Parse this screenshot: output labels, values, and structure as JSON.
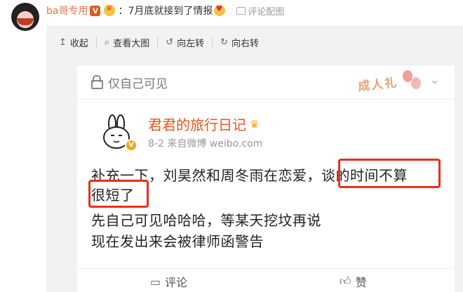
{
  "comment": {
    "username": "ba哥专用",
    "text": "7月底就接到了情报",
    "image_link": "评论配图"
  },
  "toolbar": {
    "items": [
      {
        "icon": "↥",
        "label": "收起"
      },
      {
        "icon": "⌕",
        "label": "查看大图"
      },
      {
        "icon": "↺",
        "label": "向左转"
      },
      {
        "icon": "↻",
        "label": "向右转"
      }
    ]
  },
  "screenshot": {
    "visibility": "仅自己可见",
    "badge": "成人礼",
    "post": {
      "author": "君君的旅行日记",
      "meta": "8-2  来自微博 weibo.com",
      "lines": [
        "补充一下，刘昊然和周冬雨在恋爱，谈的时间不算",
        "很短了",
        "先自己可见哈哈哈，等某天挖坟再说",
        "现在发出来会被律师函警告"
      ]
    },
    "actions": {
      "comment": "评论",
      "like": "赞"
    }
  },
  "colors": {
    "username": "#eb7350",
    "author": "#e8541e",
    "highlight_box": "#e8301d"
  }
}
